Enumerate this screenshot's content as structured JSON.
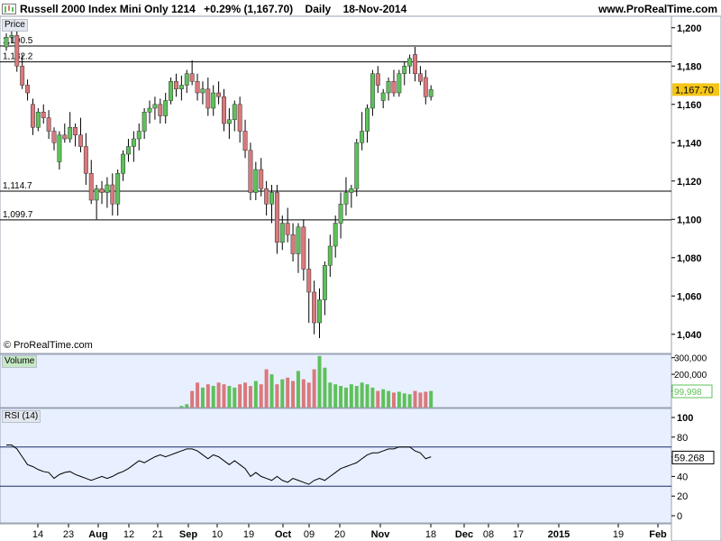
{
  "header": {
    "title": "Russell 2000 Index Mini Only 1214",
    "change": "+0.29% (1,167.70)",
    "period": "Daily",
    "date": "18-Nov-2014",
    "site": "www.ProRealTime.com"
  },
  "panels": {
    "price_tag": "Price",
    "volume_tag": "Volume",
    "rsi_tag": "RSI (14)",
    "copyright": "© ProRealTime.com"
  },
  "colors": {
    "up": "#5ec15a",
    "down": "#d9797c",
    "last_price_box": "#f5c518",
    "panel_bg": "#e8efff",
    "line": "#000000"
  },
  "chart_data": [
    {
      "type": "candlestick",
      "title": "Russell 2000 Index Mini Only 1214",
      "ylim": [
        1030,
        1206
      ],
      "y_ticks": [
        "1,200",
        "1,180",
        "1,160",
        "1,140",
        "1,120",
        "1,100",
        "1,080",
        "1,060",
        "1,040"
      ],
      "last_price": "1,167.70",
      "horizontal_levels": [
        {
          "label": "1,190.5",
          "value": 1190.5
        },
        {
          "label": "1,182.2",
          "value": 1182.2
        },
        {
          "label": "1,114.7",
          "value": 1114.7
        },
        {
          "label": "1,099.7",
          "value": 1099.7
        }
      ],
      "x_tick_labels": [
        "14",
        "23",
        "Aug",
        "12",
        "21",
        "Sep",
        "10",
        "19",
        "Oct",
        "09",
        "20",
        "Nov",
        "18",
        "Dec",
        "08",
        "17",
        "2015",
        "19",
        "Feb"
      ],
      "candles": [
        [
          1190,
          1197,
          1188,
          1195
        ],
        [
          1195,
          1199,
          1192,
          1196
        ],
        [
          1196,
          1200,
          1177,
          1180
        ],
        [
          1180,
          1186,
          1168,
          1170
        ],
        [
          1170,
          1173,
          1162,
          1166
        ],
        [
          1160,
          1163,
          1144,
          1148
        ],
        [
          1148,
          1158,
          1146,
          1156
        ],
        [
          1156,
          1160,
          1150,
          1153
        ],
        [
          1153,
          1157,
          1142,
          1146
        ],
        [
          1146,
          1148,
          1136,
          1140
        ],
        [
          1130,
          1146,
          1126,
          1144
        ],
        [
          1144,
          1150,
          1140,
          1142
        ],
        [
          1142,
          1156,
          1140,
          1148
        ],
        [
          1148,
          1150,
          1138,
          1144
        ],
        [
          1144,
          1153,
          1135,
          1138
        ],
        [
          1138,
          1145,
          1118,
          1124
        ],
        [
          1124,
          1131,
          1108,
          1110
        ],
        [
          1110,
          1118,
          1100,
          1116
        ],
        [
          1116,
          1120,
          1108,
          1114
        ],
        [
          1114,
          1122,
          1106,
          1118
        ],
        [
          1118,
          1124,
          1102,
          1108
        ],
        [
          1108,
          1126,
          1102,
          1124
        ],
        [
          1124,
          1136,
          1120,
          1134
        ],
        [
          1134,
          1142,
          1130,
          1138
        ],
        [
          1138,
          1146,
          1130,
          1142
        ],
        [
          1142,
          1150,
          1136,
          1146
        ],
        [
          1146,
          1158,
          1142,
          1156
        ],
        [
          1156,
          1162,
          1150,
          1158
        ],
        [
          1158,
          1164,
          1152,
          1160
        ],
        [
          1160,
          1163,
          1150,
          1154
        ],
        [
          1154,
          1166,
          1150,
          1162
        ],
        [
          1162,
          1174,
          1160,
          1172
        ],
        [
          1172,
          1176,
          1164,
          1168
        ],
        [
          1168,
          1175,
          1162,
          1170
        ],
        [
          1170,
          1178,
          1166,
          1176
        ],
        [
          1176,
          1183,
          1170,
          1172
        ],
        [
          1172,
          1176,
          1162,
          1166
        ],
        [
          1166,
          1172,
          1160,
          1168
        ],
        [
          1168,
          1174,
          1154,
          1158
        ],
        [
          1158,
          1170,
          1154,
          1166
        ],
        [
          1166,
          1172,
          1160,
          1164
        ],
        [
          1164,
          1168,
          1146,
          1150
        ],
        [
          1150,
          1158,
          1142,
          1152
        ],
        [
          1152,
          1162,
          1146,
          1160
        ],
        [
          1160,
          1164,
          1140,
          1146
        ],
        [
          1146,
          1152,
          1132,
          1136
        ],
        [
          1136,
          1140,
          1110,
          1114
        ],
        [
          1114,
          1130,
          1110,
          1126
        ],
        [
          1126,
          1132,
          1112,
          1116
        ],
        [
          1116,
          1120,
          1102,
          1108
        ],
        [
          1108,
          1118,
          1098,
          1114
        ],
        [
          1114,
          1118,
          1082,
          1088
        ],
        [
          1088,
          1102,
          1084,
          1098
        ],
        [
          1098,
          1106,
          1088,
          1092
        ],
        [
          1092,
          1098,
          1078,
          1082
        ],
        [
          1082,
          1098,
          1072,
          1096
        ],
        [
          1096,
          1100,
          1068,
          1074
        ],
        [
          1074,
          1090,
          1046,
          1062
        ],
        [
          1062,
          1068,
          1040,
          1046
        ],
        [
          1046,
          1064,
          1038,
          1058
        ],
        [
          1058,
          1078,
          1050,
          1076
        ],
        [
          1076,
          1092,
          1070,
          1086
        ],
        [
          1086,
          1102,
          1080,
          1098
        ],
        [
          1098,
          1114,
          1090,
          1108
        ],
        [
          1108,
          1122,
          1102,
          1114
        ],
        [
          1114,
          1118,
          1106,
          1116
        ],
        [
          1116,
          1142,
          1112,
          1140
        ],
        [
          1140,
          1156,
          1136,
          1146
        ],
        [
          1146,
          1160,
          1140,
          1158
        ],
        [
          1158,
          1178,
          1154,
          1176
        ],
        [
          1176,
          1180,
          1166,
          1170
        ],
        [
          1162,
          1168,
          1158,
          1166
        ],
        [
          1166,
          1174,
          1162,
          1172
        ],
        [
          1172,
          1178,
          1164,
          1166
        ],
        [
          1166,
          1178,
          1164,
          1176
        ],
        [
          1176,
          1182,
          1170,
          1180
        ],
        [
          1180,
          1186,
          1176,
          1184
        ],
        [
          1186,
          1190,
          1172,
          1176
        ],
        [
          1176,
          1180,
          1170,
          1172
        ],
        [
          1174,
          1178,
          1160,
          1164
        ],
        [
          1164,
          1170,
          1162,
          1167.7
        ]
      ]
    },
    {
      "type": "bar",
      "title": "Volume",
      "ylim": [
        0,
        320000
      ],
      "y_ticks": [
        "300,000",
        "200,000",
        "100,000"
      ],
      "last_value": "99,998",
      "values": [
        0,
        0,
        0,
        0,
        0,
        0,
        0,
        0,
        0,
        0,
        0,
        0,
        0,
        0,
        0,
        0,
        0,
        0,
        0,
        0,
        0,
        0,
        0,
        0,
        0,
        0,
        0,
        0,
        0,
        0,
        0,
        0,
        0,
        0,
        0,
        0,
        0,
        0,
        0,
        0,
        0,
        0,
        0,
        0,
        0,
        0,
        0,
        0,
        0,
        0,
        0,
        0,
        0,
        0,
        0,
        0,
        0,
        0,
        0,
        0,
        0,
        0,
        0,
        0,
        0,
        0,
        0,
        0,
        0,
        0,
        0,
        0,
        0,
        0,
        0,
        0,
        0,
        0,
        0,
        0,
        0
      ],
      "visible_values": [
        10000,
        20000,
        100000,
        150000,
        120000,
        140000,
        130000,
        150000,
        140000,
        130000,
        120000,
        140000,
        150000,
        130000,
        160000,
        140000,
        230000,
        200000,
        140000,
        170000,
        180000,
        160000,
        220000,
        170000,
        150000,
        230000,
        310000,
        240000,
        150000,
        140000,
        130000,
        120000,
        140000,
        130000,
        150000,
        140000,
        120000,
        100000,
        110000,
        100000,
        90000,
        95000,
        85000,
        80000,
        100000,
        90000,
        95000,
        99998
      ]
    },
    {
      "type": "line",
      "title": "RSI (14)",
      "ylim": [
        0,
        100
      ],
      "y_ticks": [
        "100",
        "80",
        "60",
        "40",
        "20",
        "0"
      ],
      "last_value": "59.268",
      "levels": [
        70,
        30
      ],
      "values": [
        72,
        72,
        68,
        60,
        52,
        50,
        47,
        45,
        44,
        38,
        42,
        44,
        45,
        42,
        40,
        38,
        36,
        38,
        40,
        38,
        40,
        43,
        45,
        48,
        52,
        56,
        54,
        57,
        60,
        62,
        60,
        62,
        64,
        66,
        68,
        68,
        66,
        62,
        58,
        62,
        60,
        56,
        52,
        56,
        52,
        48,
        40,
        44,
        40,
        38,
        36,
        40,
        36,
        34,
        38,
        36,
        34,
        32,
        36,
        38,
        36,
        40,
        44,
        48,
        50,
        52,
        54,
        58,
        62,
        64,
        64,
        66,
        68,
        68,
        70,
        70,
        70,
        66,
        64,
        58,
        60
      ]
    }
  ]
}
